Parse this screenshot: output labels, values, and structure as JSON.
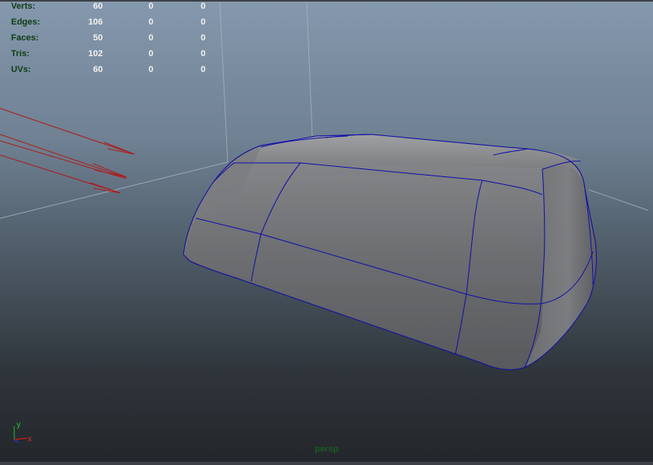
{
  "hud": {
    "rows": [
      {
        "label": "Verts:",
        "v1": "60",
        "v2": "0",
        "v3": "0"
      },
      {
        "label": "Edges:",
        "v1": "106",
        "v2": "0",
        "v3": "0"
      },
      {
        "label": "Faces:",
        "v1": "50",
        "v2": "0",
        "v3": "0"
      },
      {
        "label": "Tris:",
        "v1": "102",
        "v2": "0",
        "v3": "0"
      },
      {
        "label": "UVs:",
        "v1": "60",
        "v2": "0",
        "v3": "0"
      }
    ]
  },
  "camera": {
    "name": "persp"
  },
  "axis": {
    "y_label": "y",
    "x_label": "x"
  },
  "colors": {
    "wireframe": "#1010a8",
    "manipulator": "#b01a1a",
    "grid_line": "#9aa4ae",
    "hud_label": "#0d3c12",
    "camera_label": "#1c5a22"
  }
}
